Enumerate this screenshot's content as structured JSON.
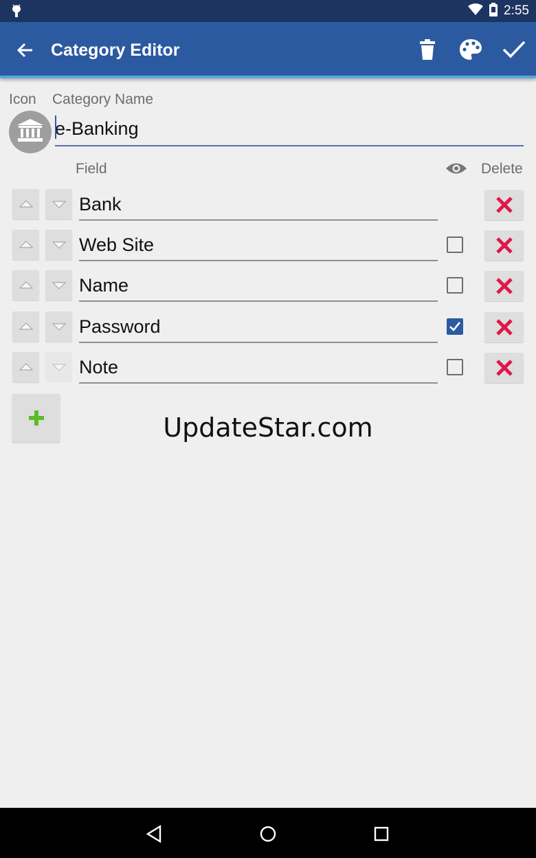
{
  "status_bar": {
    "time": "2:55",
    "icons": [
      "android-icon",
      "wifi-icon",
      "battery-icon"
    ]
  },
  "app_bar": {
    "title": "Category Editor",
    "background": "#2c5aa0",
    "actions": [
      "back-arrow-icon",
      "trash-icon",
      "palette-icon",
      "check-icon"
    ]
  },
  "category": {
    "icon_label": "Icon",
    "name_label": "Category Name",
    "name_value": "e-Banking",
    "icon": "bank-icon"
  },
  "fields_header": {
    "field_label": "Field",
    "visibility_icon": "eye-icon",
    "delete_label": "Delete"
  },
  "fields": [
    {
      "name": "Bank",
      "has_checkbox": false,
      "checked": false
    },
    {
      "name": "Web Site",
      "has_checkbox": true,
      "checked": false
    },
    {
      "name": "Name",
      "has_checkbox": true,
      "checked": false
    },
    {
      "name": "Password",
      "has_checkbox": true,
      "checked": true
    },
    {
      "name": "Note",
      "has_checkbox": true,
      "checked": false
    }
  ],
  "add_button_icon": "plus-icon",
  "watermark": "UpdateStar.com",
  "colors": {
    "accent": "#2c5aa0",
    "delete": "#e0174a",
    "add": "#5cbb2a",
    "status_bar": "#1d3461"
  }
}
